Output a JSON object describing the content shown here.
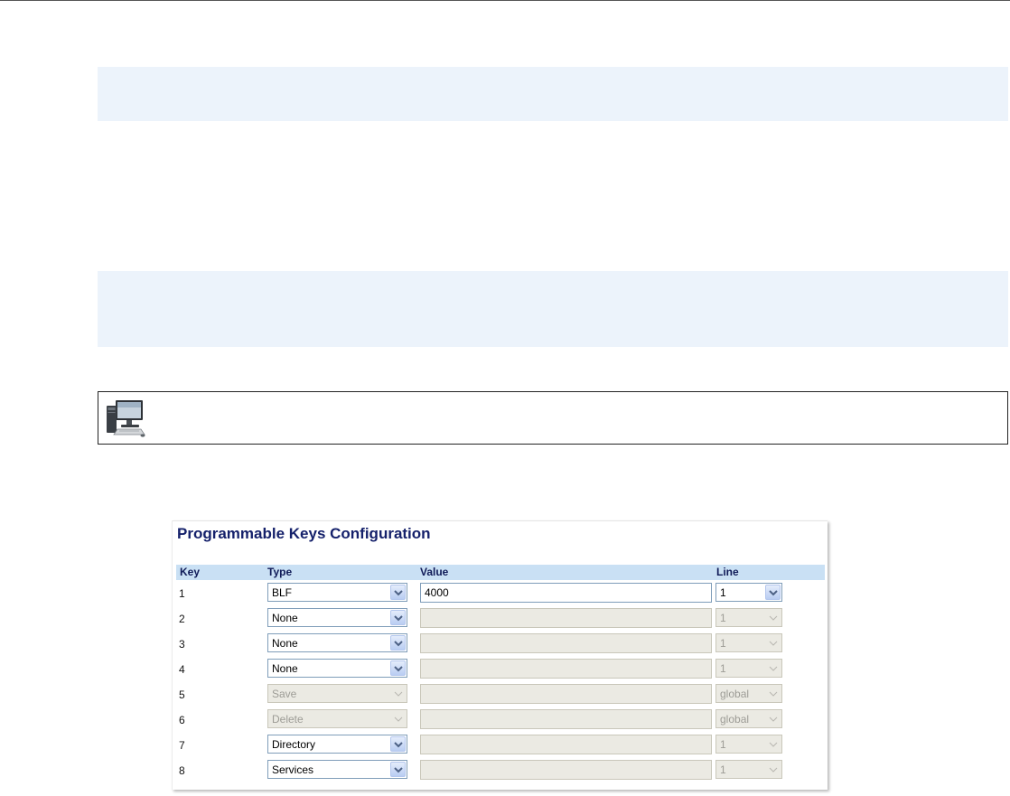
{
  "panel": {
    "title": "Programmable Keys Configuration",
    "headers": {
      "key": "Key",
      "type": "Type",
      "value": "Value",
      "line": "Line"
    },
    "rows": [
      {
        "key": "1",
        "type": "BLF",
        "type_disabled": false,
        "value": "4000",
        "value_disabled": false,
        "line": "1",
        "line_disabled": false
      },
      {
        "key": "2",
        "type": "None",
        "type_disabled": false,
        "value": "",
        "value_disabled": true,
        "line": "1",
        "line_disabled": true
      },
      {
        "key": "3",
        "type": "None",
        "type_disabled": false,
        "value": "",
        "value_disabled": true,
        "line": "1",
        "line_disabled": true
      },
      {
        "key": "4",
        "type": "None",
        "type_disabled": false,
        "value": "",
        "value_disabled": true,
        "line": "1",
        "line_disabled": true
      },
      {
        "key": "5",
        "type": "Save",
        "type_disabled": true,
        "value": "",
        "value_disabled": true,
        "line": "global",
        "line_disabled": true
      },
      {
        "key": "6",
        "type": "Delete",
        "type_disabled": true,
        "value": "",
        "value_disabled": true,
        "line": "global",
        "line_disabled": true
      },
      {
        "key": "7",
        "type": "Directory",
        "type_disabled": false,
        "value": "",
        "value_disabled": true,
        "line": "1",
        "line_disabled": true
      },
      {
        "key": "8",
        "type": "Services",
        "type_disabled": false,
        "value": "",
        "value_disabled": true,
        "line": "1",
        "line_disabled": true
      }
    ]
  },
  "note_icon": "desktop-computer-icon",
  "colors": {
    "band": "#ecf3fb",
    "title": "#15216b",
    "header_bg": "#c9e0f4",
    "field_border": "#7f9db9",
    "disabled_bg": "#ebeae3"
  }
}
